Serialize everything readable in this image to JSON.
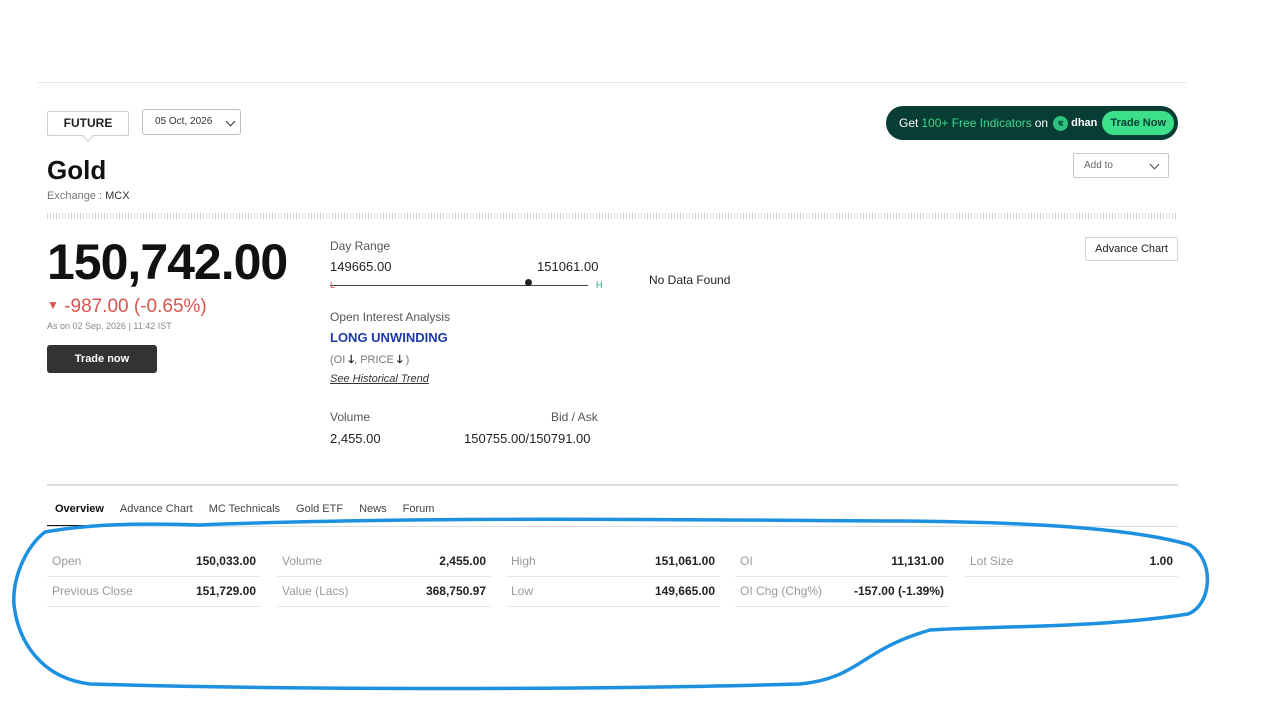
{
  "header": {
    "contract_type": "FUTURE",
    "expiry_selected": "05 Oct, 2026"
  },
  "promo": {
    "prefix": "Get",
    "highlight": "100+ Free Indicators",
    "on": "on",
    "brand": "dhan",
    "cta": "Trade Now"
  },
  "instrument": {
    "name": "Gold",
    "exchange_label": "Exchange :",
    "exchange": "MCX",
    "add_to": "Add to"
  },
  "quote": {
    "price": "150,742.00",
    "change": "-987.00 (-0.65%)",
    "as_on": "As on 02 Sep, 2026 | 11:42 IST",
    "trade_now": "Trade now",
    "advance_chart": "Advance Chart"
  },
  "day_range": {
    "label": "Day Range",
    "low": "149665.00",
    "high": "151061.00",
    "low_tag": "L",
    "high_tag": "H",
    "current_fraction": 0.77
  },
  "oi_analysis": {
    "label": "Open Interest Analysis",
    "status": "LONG UNWINDING",
    "oi_text": "(OI",
    "price_text": ", PRICE",
    "close": ")",
    "link": "See Historical Trend"
  },
  "volume": {
    "label": "Volume",
    "value": "2,455.00",
    "bid_ask_label": "Bid / Ask",
    "bid_ask": "150755.00/150791.00"
  },
  "side_panel": {
    "message": "No Data Found"
  },
  "tabs": [
    "Overview",
    "Advance Chart",
    "MC Technicals",
    "Gold ETF",
    "News",
    "Forum"
  ],
  "stats": {
    "open": {
      "label": "Open",
      "value": "150,033.00"
    },
    "prev_close": {
      "label": "Previous Close",
      "value": "151,729.00"
    },
    "volume": {
      "label": "Volume",
      "value": "2,455.00"
    },
    "value_lacs": {
      "label": "Value (Lacs)",
      "value": "368,750.97"
    },
    "high": {
      "label": "High",
      "value": "151,061.00"
    },
    "low": {
      "label": "Low",
      "value": "149,665.00"
    },
    "oi": {
      "label": "OI",
      "value": "11,131.00"
    },
    "oi_chg": {
      "label": "OI Chg (Chg%)",
      "value": "-157.00 (-1.39%)"
    },
    "lot_size": {
      "label": "Lot Size",
      "value": "1.00"
    }
  },
  "colors": {
    "negative": "#d9534f",
    "oi_status": "#1e3aa8",
    "promo_bg": "#073d35",
    "promo_accent": "#3ce08a",
    "annotation": "#1e90e0"
  }
}
